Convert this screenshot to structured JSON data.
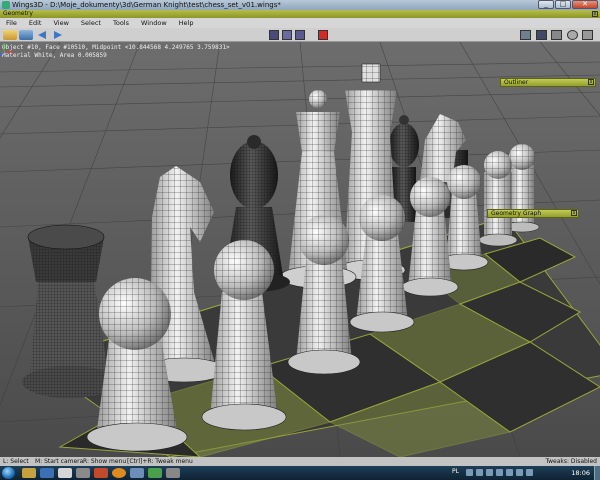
{
  "window": {
    "title": "Wings3D - D:\\Moje_dokumenty\\3d\\German Knight\\test\\chess_set_v01.wings*",
    "buttons": {
      "minimize": "_",
      "maximize": "□",
      "close": "✕"
    }
  },
  "geometry_bar": {
    "label": "Geometry",
    "close": "x"
  },
  "menu": {
    "items": [
      "File",
      "Edit",
      "View",
      "Select",
      "Tools",
      "Window",
      "Help"
    ]
  },
  "toolbar": {
    "icons": [
      "open-icon",
      "save-icon",
      "undo-arrow-icon",
      "redo-arrow-icon"
    ],
    "selection_modes": [
      "vertex",
      "edge",
      "face",
      "body"
    ],
    "view_icons": [
      "grid-icon",
      "cube-icon",
      "perspective-icon",
      "lights-icon",
      "camera-icon"
    ]
  },
  "viewport": {
    "info_line1": "Object #10, Face #10510, Midpoint <10.844568  4.249765  3.759831>",
    "info_line2": "Material White, Area 0.005859"
  },
  "panels": {
    "outliner": {
      "title": "Outliner",
      "close": "x"
    },
    "geometry_graph": {
      "title": "Geometry Graph",
      "close": "x"
    }
  },
  "status": {
    "l_select": "L: Select",
    "m_camera": "M: Start camera",
    "r_menu": "R: Show menu",
    "ctrl_tweak": "[Ctrl]+R: Tweak menu",
    "tweak": "Tweaks: Disabled"
  },
  "taskbar": {
    "lang": "PL",
    "clock": "18:06"
  },
  "colors": {
    "panel_green": "#b6bf4a",
    "board_light": "#7c8a3a",
    "board_dark": "#3a3a3a",
    "select_body": "#d12a2a"
  }
}
